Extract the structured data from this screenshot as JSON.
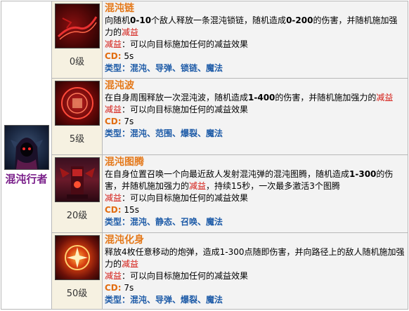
{
  "hero": {
    "name": "混沌行者",
    "icon": "hooded-chaos-walker-portrait"
  },
  "labels": {
    "debuff": "减益",
    "cd": "CD",
    "type": "类型"
  },
  "skills": [
    {
      "name": "混沌链",
      "icon": "chaos-chain-icon",
      "level": "0级",
      "desc_a": "向随机",
      "desc_b": "0-10",
      "desc_c": "个敌人释放一条混沌锁链，随机造成",
      "desc_d": "0-200",
      "desc_e": "的伤害，并随机施加强力的",
      "desc_red": "减益",
      "debuff_text": "：可以向目标施加任何的减益效果",
      "cd": "5s",
      "tags": "混沌、导弹、锁链、魔法"
    },
    {
      "name": "混沌波",
      "icon": "chaos-wave-icon",
      "level": "5级",
      "desc_a": "在自身周围释放一次混沌波，随机造成",
      "desc_b": "1-400",
      "desc_c": "的伤害，并随机施加强力的",
      "desc_red": "减益",
      "debuff_text": "：可以向目标施加任何的减益效果",
      "cd": "7s",
      "tags": "混沌、范围、爆裂、魔法"
    },
    {
      "name": "混沌图腾",
      "icon": "chaos-totem-icon",
      "level": "20级",
      "desc_a": "在自身位置召唤一个向最近敌人发射混沌弹的混沌图腾，随机造成",
      "desc_b": "1-300",
      "desc_c": "的伤害，并随机施加强力的",
      "desc_red": "减益",
      "desc_e": "，持续15秒，一次最多激活3个图腾",
      "debuff_text": "：可以向目标施加任何的减益效果",
      "cd": "15s",
      "tags": "混沌、静态、召唤、魔法"
    },
    {
      "name": "混沌化身",
      "icon": "chaos-avatar-icon",
      "level": "50级",
      "desc_a": "释放4枚任意移动的炮弹，造成1-300点随即伤害，并向路径上的敌人随机施加强力的",
      "desc_red": "减益",
      "debuff_text": "：可以向目标施加任何的减益效果",
      "cd": "7s",
      "tags": "混沌、导弹、爆裂、魔法"
    }
  ],
  "colors": {
    "skill_name": "#e47819",
    "debuff": "#d3160f",
    "tags": "#1f5ca8",
    "hero_name": "#7a1f8a",
    "row_bg": "#f3f3f3",
    "icon_cell_bg": "#f6f1e1"
  }
}
